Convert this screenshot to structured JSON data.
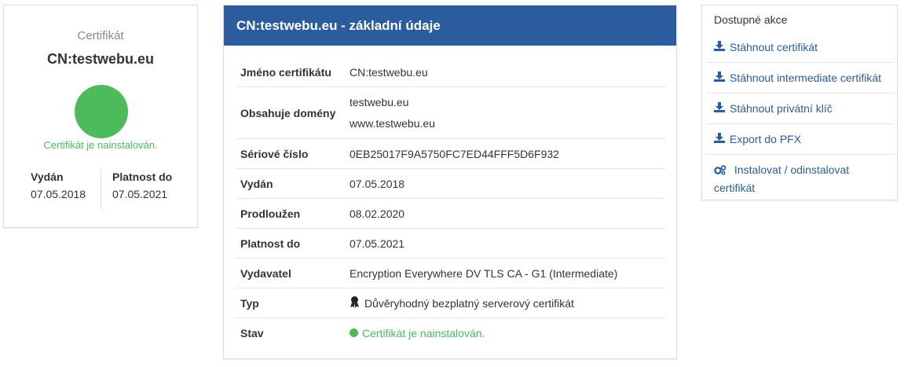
{
  "summary": {
    "label": "Certifikát",
    "name": "CN:testwebu.eu",
    "status_text": "Certifikát je nainstalován.",
    "issued_label": "Vydán",
    "issued_value": "07.05.2018",
    "valid_label": "Platnost do",
    "valid_value": "07.05.2021",
    "status_color": "#4cbb5a"
  },
  "panel": {
    "title": "CN:testwebu.eu - základní údaje",
    "header_color": "#2a5c9e",
    "rows": [
      {
        "key": "Jméno certifikátu",
        "value": "CN:testwebu.eu"
      },
      {
        "key": "Obsahuje domény",
        "values": [
          "testwebu.eu",
          "www.testwebu.eu"
        ]
      },
      {
        "key": "Sériové číslo",
        "value": "0EB25017F9A5750FC7ED44FFF5D6F932"
      },
      {
        "key": "Vydán",
        "value": "07.05.2018"
      },
      {
        "key": "Prodloužen",
        "value": "08.02.2020"
      },
      {
        "key": "Platnost do",
        "value": "07.05.2021"
      },
      {
        "key": "Vydavatel",
        "value": "Encryption Everywhere DV TLS CA - G1 (Intermediate)"
      },
      {
        "key": "Typ",
        "value": "Důvěryhodný bezplatný serverový certifikát",
        "icon": "ribbon-icon"
      },
      {
        "key": "Stav",
        "value": "Certifikát je nainstalován.",
        "icon": "status-dot"
      }
    ]
  },
  "actions": {
    "title": "Dostupné akce",
    "items": [
      {
        "label": "Stáhnout certifikát",
        "icon": "download-icon"
      },
      {
        "label": "Stáhnout intermediate certifikát",
        "icon": "download-icon"
      },
      {
        "label": "Stáhnout privátní klíč",
        "icon": "download-icon"
      },
      {
        "label": "Export do PFX",
        "icon": "download-icon"
      },
      {
        "label": "Instalovat / odinstalovat certifikát",
        "icon": "cogs-icon"
      }
    ]
  }
}
